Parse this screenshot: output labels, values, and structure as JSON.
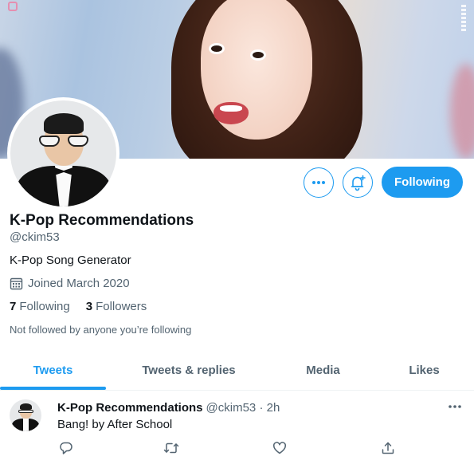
{
  "profile": {
    "name": "K-Pop Recommendations",
    "handle": "@ckim53",
    "bio": "K-Pop Song Generator",
    "joined": "Joined March 2020",
    "following_count": "7",
    "following_label": "Following",
    "followers_count": "3",
    "followers_label": "Followers",
    "not_followed": "Not followed by anyone you’re following"
  },
  "actions": {
    "more_icon": "more-icon",
    "notify_icon": "bell-plus-icon",
    "following_button": "Following"
  },
  "tabs": [
    {
      "label": "Tweets",
      "active": true
    },
    {
      "label": "Tweets & replies",
      "active": false
    },
    {
      "label": "Media",
      "active": false
    },
    {
      "label": "Likes",
      "active": false
    }
  ],
  "tweet": {
    "author": "K-Pop Recommendations",
    "meta": "@ckim53 · 2h",
    "text": "Bang! by After School",
    "actions": [
      "reply-icon",
      "retweet-icon",
      "like-icon",
      "share-icon"
    ]
  },
  "colors": {
    "accent": "#1d9bf0",
    "text": "#0f1419",
    "secondary": "#536471"
  }
}
